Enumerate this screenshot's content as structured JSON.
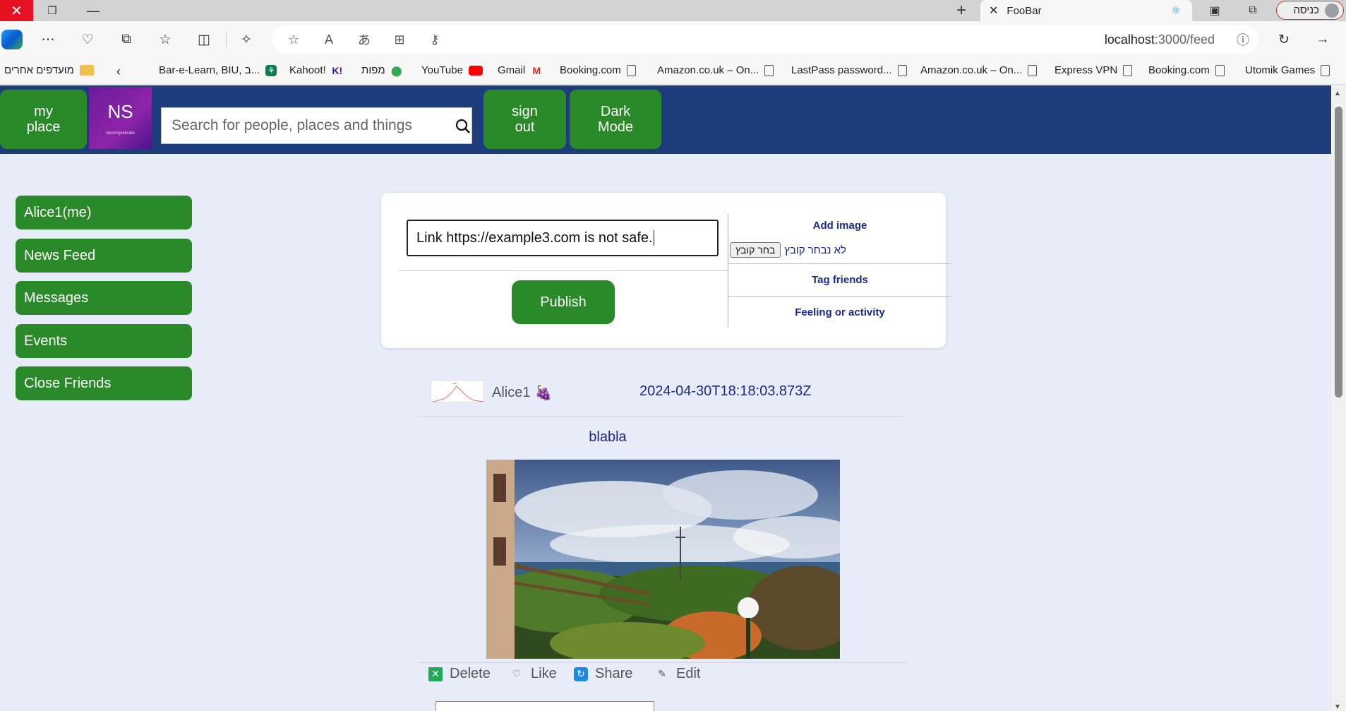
{
  "browser": {
    "tab_title": "FooBar",
    "tab_close": "✕",
    "profile_label": "כניסה",
    "url_host": "localhost",
    "url_path": ":3000/feed",
    "bookmarks_other": "מועדפים אחרים",
    "bookmarks": [
      {
        "label": "Bar-e-Learn, BIU, ב...",
        "icon": "bookmark-icon"
      },
      {
        "label": "Kahoot!",
        "icon": "kahoot-icon"
      },
      {
        "label": "מפות",
        "icon": "maps-icon"
      },
      {
        "label": "YouTube",
        "icon": "youtube-icon"
      },
      {
        "label": "Gmail",
        "icon": "gmail-icon"
      },
      {
        "label": "Booking.com",
        "icon": "document-icon"
      },
      {
        "label": "Amazon.co.uk – On...",
        "icon": "document-icon"
      },
      {
        "label": "LastPass password...",
        "icon": "document-icon"
      },
      {
        "label": "Amazon.co.uk – On...",
        "icon": "document-icon"
      },
      {
        "label": "Express VPN",
        "icon": "document-icon"
      },
      {
        "label": "Booking.com",
        "icon": "document-icon"
      },
      {
        "label": "Utomik Games",
        "icon": "document-icon"
      }
    ]
  },
  "header": {
    "my_place": "my\nplace",
    "avatar_initials": "NS",
    "avatar_caption": "NeonSyndicate",
    "search_placeholder": "Search for people, places and things",
    "sign_out": "sign\nout",
    "dark_mode": "Dark\nMode"
  },
  "sidebar": {
    "items": [
      {
        "label": "Alice1(me)"
      },
      {
        "label": "News Feed"
      },
      {
        "label": "Messages"
      },
      {
        "label": "Events"
      },
      {
        "label": "Close Friends"
      }
    ]
  },
  "composer": {
    "input_value": "Link https://example3.com is not safe.",
    "publish": "Publish",
    "add_image": "Add image",
    "choose_file": "בחר קובץ",
    "no_file": "לא נבחר קובץ",
    "tag_friends": "Tag friends",
    "feeling": "Feeling or activity"
  },
  "post": {
    "author": "Alice1",
    "author_emoji": "🍇",
    "timestamp": "2024-04-30T18:18:03.873Z",
    "text": "blabla",
    "actions": {
      "delete": "Delete",
      "like": "Like",
      "share": "Share",
      "edit": "Edit"
    }
  },
  "colors": {
    "header_bg": "#1d3c7b",
    "button_green": "#2a8a2a",
    "page_bg": "#e8ecf8",
    "link_blue": "#1a2a8a"
  }
}
